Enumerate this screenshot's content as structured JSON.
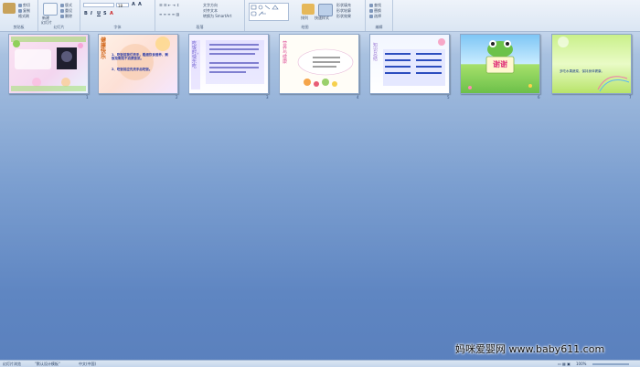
{
  "ribbon": {
    "clipboard_label": "剪贴板",
    "slides_label": "幻灯片",
    "font_label": "字体",
    "paragraph_label": "段落",
    "drawing_label": "绘图",
    "editing_label": "编辑",
    "format_painter": "格式刷",
    "new_slide": "新建",
    "new_slide2": "幻灯片",
    "font_size": "18",
    "text_direction": "文字方向",
    "align_text": "对齐文本",
    "smartart": "转换为 SmartArt",
    "arrange": "排列",
    "quick_styles": "快速样式",
    "shape_fill": "形状填充",
    "shape_outline": "形状轮廓",
    "shape_effects": "形状效果",
    "find": "查找",
    "replace": "替换",
    "select": "选择"
  },
  "slides": [
    {
      "number": "1",
      "title": "",
      "text": ""
    },
    {
      "number": "2",
      "title": "健康快乐",
      "line1": "1、吃饭前我们洗手，粗细饮食营养、剩饭菜剩菜不浪费饭菜。",
      "line2": "2、吃饭前应先洗手后吃饭。"
    },
    {
      "number": "3",
      "title": "吃饭时，快乐吃",
      "text": "饮食要有营养"
    },
    {
      "number": "4",
      "title": "营养与健康",
      "text": "饮食要多样化"
    },
    {
      "number": "5",
      "title": "知识总结",
      "text": ""
    },
    {
      "number": "6",
      "title": "谢谢",
      "text": ""
    },
    {
      "number": "7",
      "title": "",
      "text": "多吃水果蔬菜，保持身体健康。"
    }
  ],
  "status": {
    "slide_sorter": "幻灯片浏览",
    "theme": "\"默认设计模板\"",
    "language": "中文(中国)",
    "zoom": "100%"
  },
  "watermark": "妈咪爱婴网 www.baby611.com"
}
